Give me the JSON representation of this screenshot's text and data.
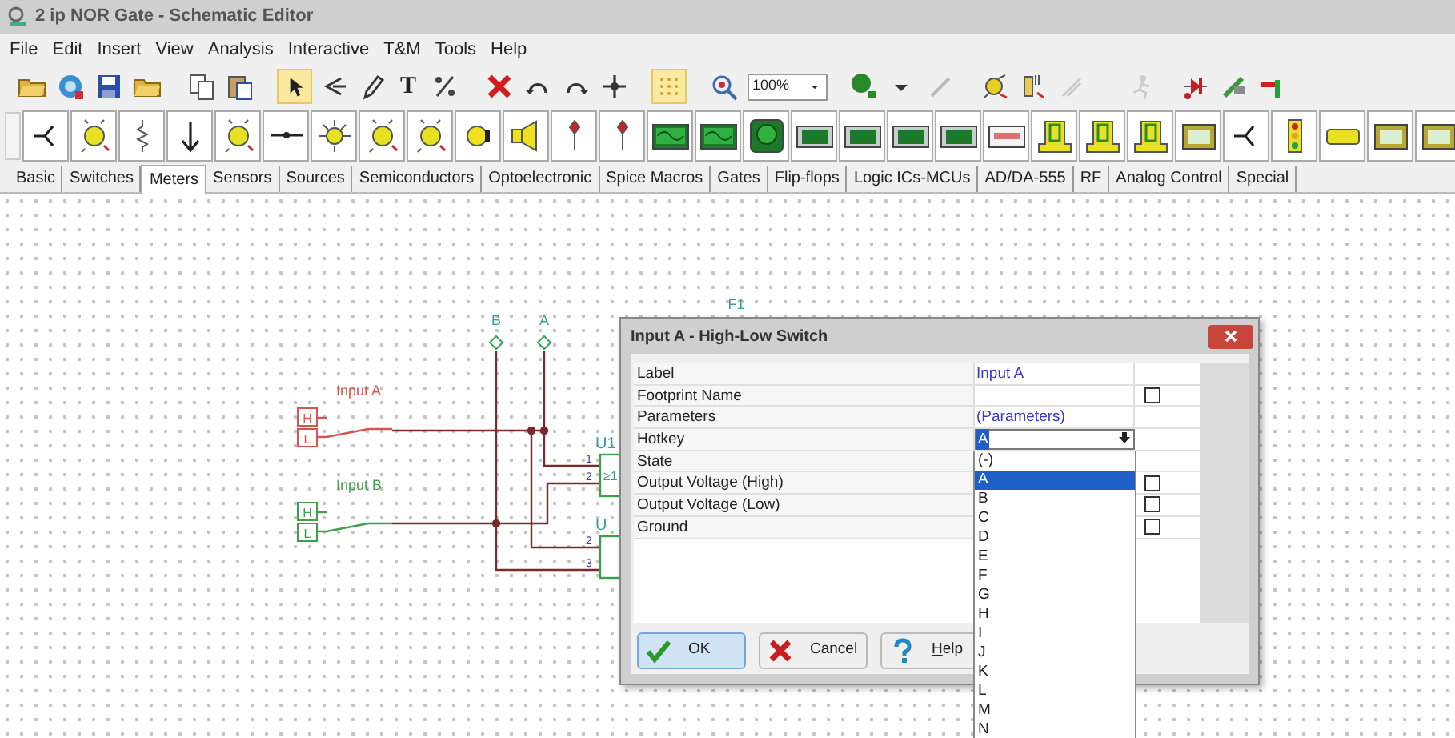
{
  "window": {
    "title": "2 ip NOR Gate - Schematic Editor"
  },
  "menu": [
    "File",
    "Edit",
    "Insert",
    "View",
    "Analysis",
    "Interactive",
    "T&M",
    "Tools",
    "Help"
  ],
  "toolbar": {
    "text_tool": "T",
    "zoom": "100%"
  },
  "component_tabs": [
    {
      "label": "Basic",
      "selected": false
    },
    {
      "label": "Switches",
      "selected": false
    },
    {
      "label": "Meters",
      "selected": true
    },
    {
      "label": "Sensors",
      "selected": false
    },
    {
      "label": "Sources",
      "selected": false
    },
    {
      "label": "Semiconductors",
      "selected": false
    },
    {
      "label": "Optoelectronic",
      "selected": false
    },
    {
      "label": "Spice Macros",
      "selected": false
    },
    {
      "label": "Gates",
      "selected": false
    },
    {
      "label": "Flip-flops",
      "selected": false
    },
    {
      "label": "Logic ICs-MCUs",
      "selected": false
    },
    {
      "label": "AD/DA-555",
      "selected": false
    },
    {
      "label": "RF",
      "selected": false
    },
    {
      "label": "Analog Control",
      "selected": false
    },
    {
      "label": "Special",
      "selected": false
    }
  ],
  "schematic": {
    "probes": [
      {
        "label": "B"
      },
      {
        "label": "A"
      }
    ],
    "switches": [
      {
        "label": "Input A",
        "high": "H",
        "low": "L",
        "color": "#d9534f"
      },
      {
        "label": "Input B",
        "high": "H",
        "low": "L",
        "color": "#3f9f4a"
      }
    ],
    "gates": [
      {
        "label": "U1",
        "symbol": "≥1",
        "pins": [
          "1",
          "2"
        ]
      },
      {
        "label": "U",
        "pins": [
          "2",
          "3"
        ]
      }
    ],
    "part_label": "F1"
  },
  "dialog": {
    "title": "Input A - High-Low Switch",
    "properties": [
      {
        "name": "Label",
        "kind": "text",
        "value": "Input A"
      },
      {
        "name": "Footprint Name",
        "kind": "checkbox",
        "checked": false
      },
      {
        "name": "Parameters",
        "kind": "text",
        "value": "(Parameters)"
      },
      {
        "name": "Hotkey",
        "kind": "dropdown",
        "value": "A"
      },
      {
        "name": "State",
        "kind": "text"
      },
      {
        "name": "Output Voltage (High)",
        "kind": "checkbox",
        "checked": false
      },
      {
        "name": "Output Voltage (Low)",
        "kind": "checkbox",
        "checked": false
      },
      {
        "name": "Ground",
        "kind": "checkbox",
        "checked": false
      }
    ],
    "dropdown": [
      {
        "label": "(-)",
        "selected": false
      },
      {
        "label": "A",
        "selected": true
      },
      {
        "label": "B",
        "selected": false
      },
      {
        "label": "C",
        "selected": false
      },
      {
        "label": "D",
        "selected": false
      },
      {
        "label": "E",
        "selected": false
      },
      {
        "label": "F",
        "selected": false
      },
      {
        "label": "G",
        "selected": false
      },
      {
        "label": "H",
        "selected": false
      },
      {
        "label": "I",
        "selected": false
      },
      {
        "label": "J",
        "selected": false
      },
      {
        "label": "K",
        "selected": false
      },
      {
        "label": "L",
        "selected": false
      },
      {
        "label": "M",
        "selected": false
      },
      {
        "label": "N",
        "selected": false
      }
    ],
    "buttons": [
      {
        "label": "OK",
        "kind": "ok",
        "default": true
      },
      {
        "label": "Cancel",
        "kind": "cancel",
        "default": false
      },
      {
        "label": "Help",
        "kind": "help",
        "default": false
      }
    ]
  }
}
